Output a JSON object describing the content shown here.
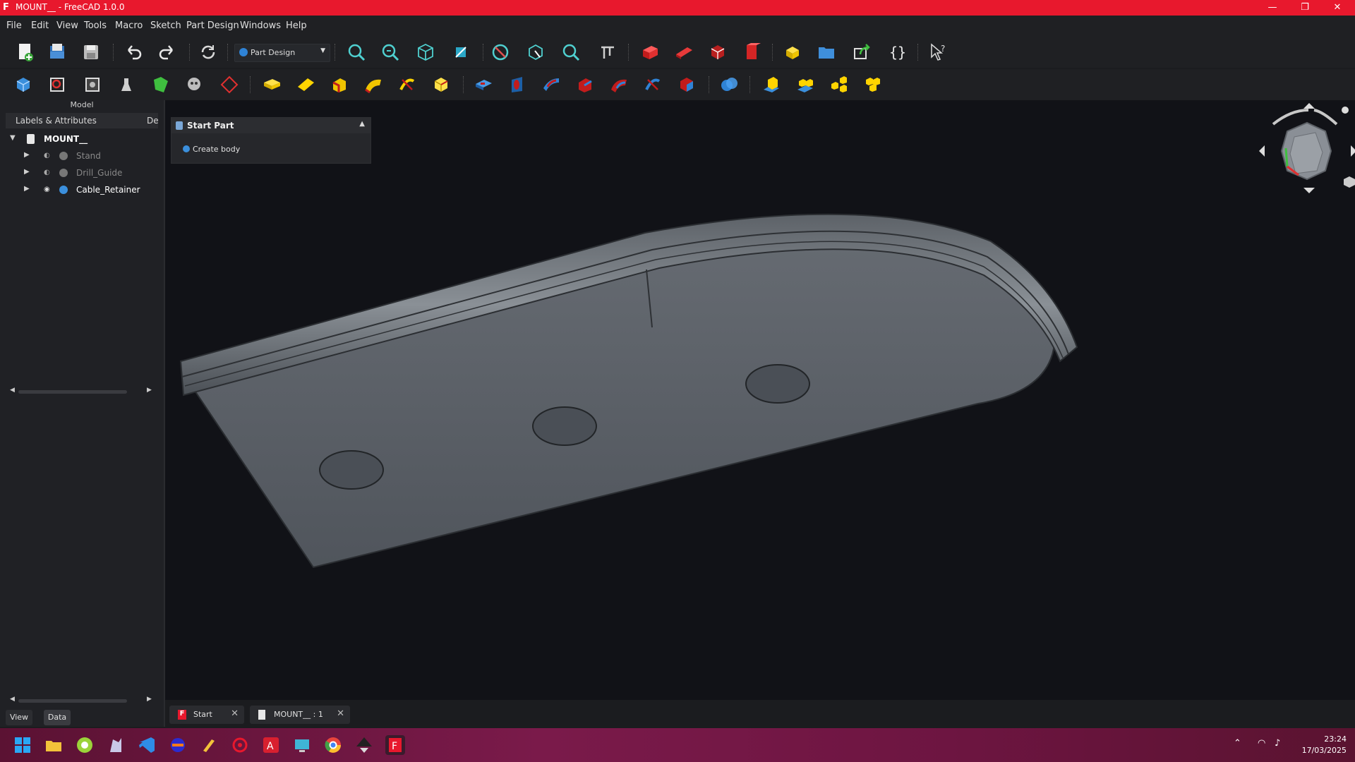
{
  "window": {
    "title": "MOUNT__ - FreeCAD 1.0.0",
    "controls": {
      "minimize": "—",
      "restore": "❐",
      "close": "✕"
    }
  },
  "menu": [
    "File",
    "Edit",
    "View",
    "Tools",
    "Macro",
    "Sketch",
    "Part Design",
    "Windows",
    "Help"
  ],
  "toolbar": {
    "workbench": "Part Design"
  },
  "left_panel": {
    "title": "Model",
    "tree_header": {
      "col1": "Labels & Attributes",
      "col2": "De"
    },
    "tree": [
      {
        "label": "MOUNT__",
        "level": 0,
        "expanded": true,
        "visible": true
      },
      {
        "label": "Stand",
        "level": 1,
        "expanded": false,
        "visible": false
      },
      {
        "label": "Drill_Guide",
        "level": 1,
        "expanded": false,
        "visible": false
      },
      {
        "label": "Cable_Retainer",
        "level": 1,
        "expanded": false,
        "visible": true
      }
    ],
    "tabs": [
      "View",
      "Data"
    ]
  },
  "task_panel": {
    "title": "Start Part",
    "action": "Create body"
  },
  "doc_tabs": [
    {
      "label": "Start"
    },
    {
      "label": "MOUNT__ : 1"
    }
  ],
  "taskbar": {
    "time": "23:24",
    "date": "17/03/2025"
  },
  "colors": {
    "titlebar": "#e8182d",
    "taskbar": "#6d1541",
    "viewport_bg": "#111217",
    "part": "#555a60"
  }
}
